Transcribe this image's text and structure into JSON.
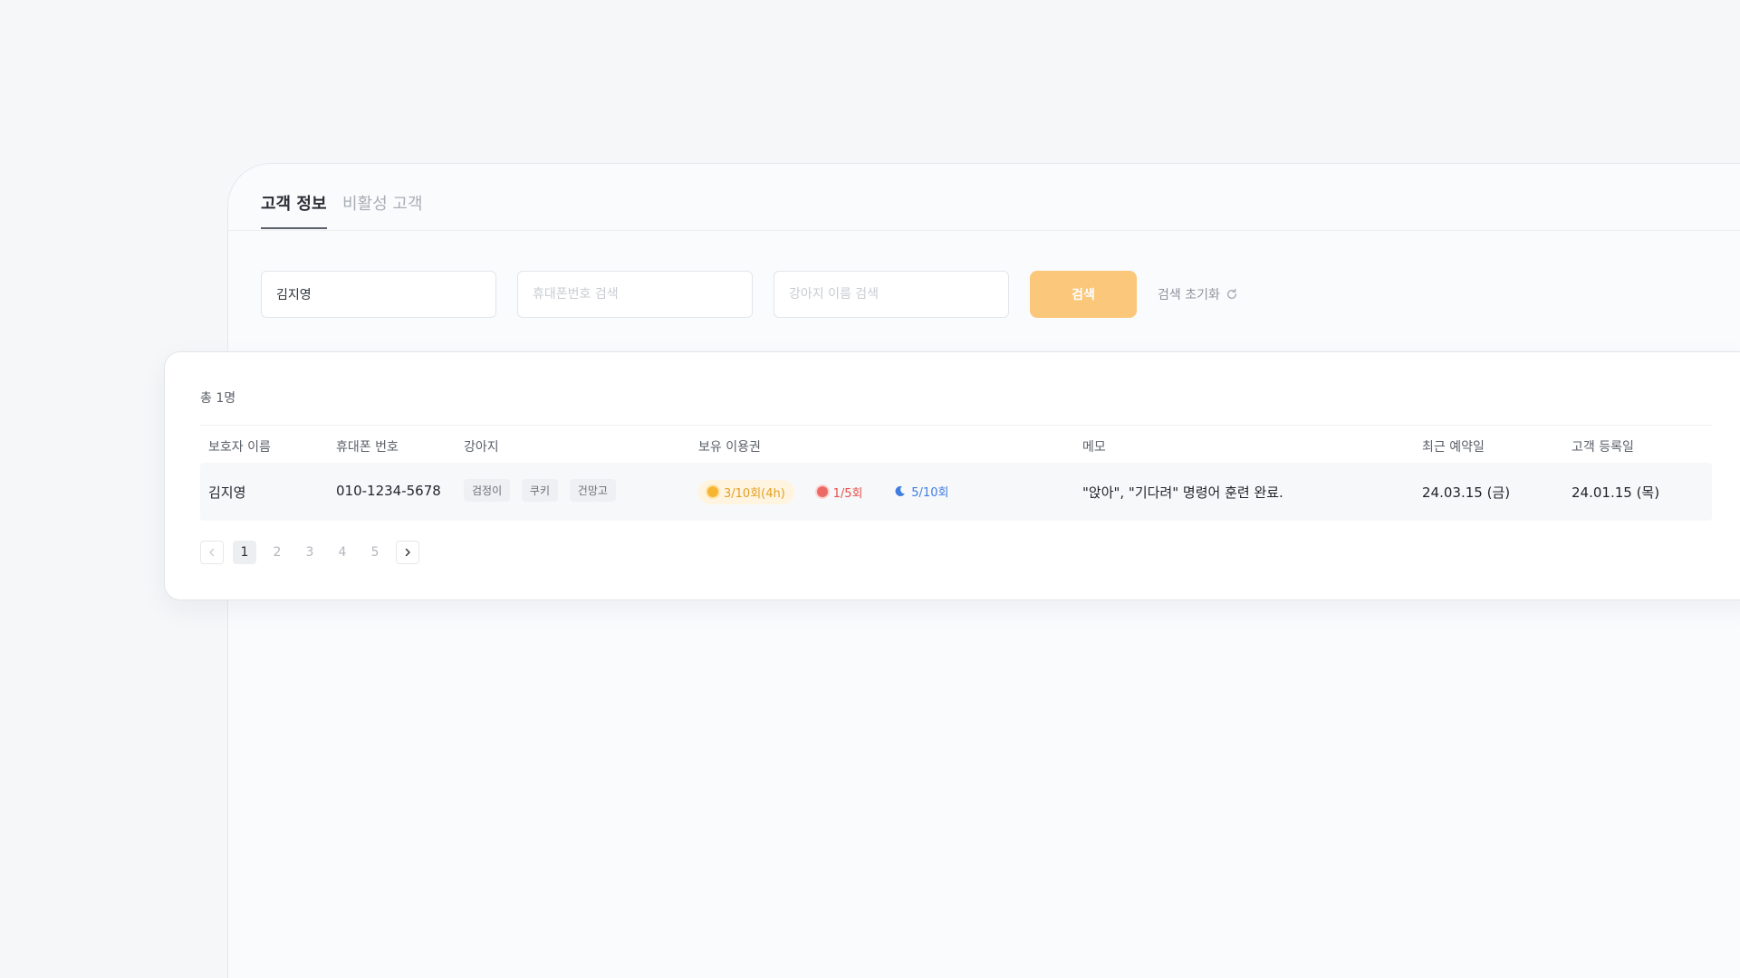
{
  "tabs": [
    {
      "label": "고객 정보",
      "active": true
    },
    {
      "label": "비활성 고객",
      "active": false
    }
  ],
  "search": {
    "name_value": "김지영",
    "phone_placeholder": "휴대폰번호 검색",
    "dog_placeholder": "강아지 이름 검색",
    "search_label": "검색",
    "reset_label": "검색 초기화"
  },
  "results": {
    "total": "총 1명",
    "columns": [
      "보호자 이름",
      "휴대폰 번호",
      "강아지",
      "보유 이용권",
      "메모",
      "최근 예약일",
      "고객 등록일"
    ],
    "rows": [
      {
        "guardian": "김지영",
        "phone": "010-1234-5678",
        "dogs": [
          "검정이",
          "쿠키",
          "건망고"
        ],
        "passes": [
          {
            "icon": "sun-icon",
            "label": "3/10회(4h)",
            "color": "#e3a024"
          },
          {
            "icon": "burst-icon",
            "label": "1/5회",
            "color": "#e2524c"
          },
          {
            "icon": "moon-icon",
            "label": "5/10회",
            "color": "#3f7de0"
          }
        ],
        "memo": "\"앉아\", \"기다려\" 명령어 훈련 완료.",
        "last_reservation": "24.03.15 (금)",
        "registered": "24.01.15 (목)"
      }
    ]
  },
  "pagination": {
    "pages": [
      "1",
      "2",
      "3",
      "4",
      "5"
    ],
    "current": "1"
  },
  "colors": {
    "accent": "#fbc77a",
    "background": "#f6f7f9"
  }
}
